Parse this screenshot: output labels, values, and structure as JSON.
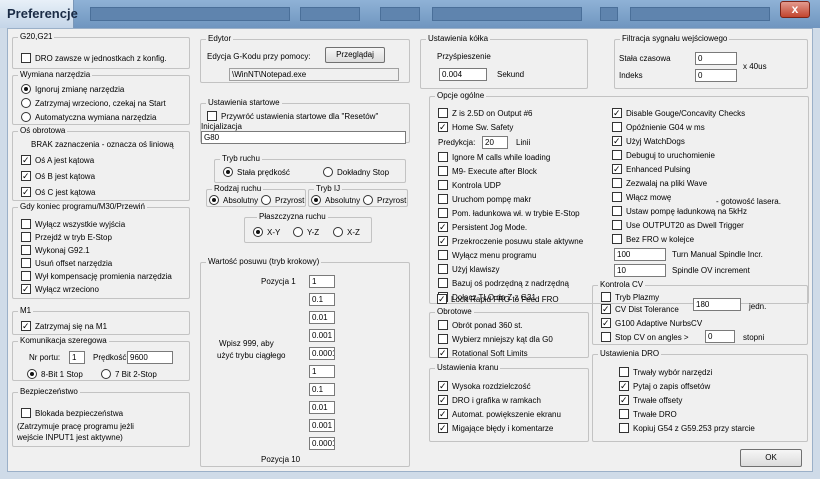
{
  "window": {
    "title": "Preferencje",
    "close_glyph": "x"
  },
  "g20": {
    "title": "G20,G21",
    "dro_units": "DRO zawsze w jednostkach z konfig."
  },
  "tool_change": {
    "title": "Wymiana narzędzia",
    "ignore": "Ignoruj zmianę narzędzia",
    "stop_spindle": "Zatrzymaj wrzeciono, czekaj na Start",
    "auto": "Automatyczna wymiana narzędzia"
  },
  "rotary": {
    "title": "Oś obrotowa",
    "note": "BRAK zaznaczenia - oznacza oś liniową",
    "a": "Oś A jest kątowa",
    "b": "Oś B jest kątowa",
    "c": "Oś C jest kątowa"
  },
  "program_end": {
    "title": "Gdy koniec programu/M30/Przewiń",
    "items": [
      "Wyłącz wszystkie wyjścia",
      "Przejdź w tryb E-Stop",
      "Wykonaj G92.1",
      "Usuń offset narzędzia",
      "Wył kompensację promienia narzędzia",
      "Wyłącz wrzeciono"
    ]
  },
  "m1": {
    "title": "M1",
    "label": "Zatrzymaj się na M1"
  },
  "serial": {
    "title": "Komunikacja szeregowa",
    "port_label": "Nr portu:",
    "port": "1",
    "speed_label": "Prędkość",
    "speed": "9600",
    "opt1": "8-Bit 1 Stop",
    "opt2": "7 Bit 2-Stop"
  },
  "safety": {
    "title": "Bezpieczeństwo",
    "lock": "Blokada bezpieczeństwa",
    "note1": "(Zatrzymuje pracę programu jeżli",
    "note2": "wejście INPUT1 jest aktywne)"
  },
  "editor": {
    "title": "Edytor",
    "label": "Edycja G-Kodu przy pomocy:",
    "browse": "Przeglądaj",
    "path": "\\WinNT\\Notepad.exe"
  },
  "startup": {
    "title": "Ustawienia startowe",
    "restore": "Przywróć ustawienia startowe dla \"Resetów\"",
    "init_label": "Inicjalizacja",
    "init_value": "G80"
  },
  "run_mode": {
    "title": "Tryb ruchu",
    "const": "Stała prędkość",
    "exact": "Dokładny Stop"
  },
  "move_type": {
    "title": "Rodzaj ruchu",
    "abs": "Absolutny",
    "inc": "Przyrost"
  },
  "ij_mode": {
    "title": "Tryb IJ",
    "abs": "Absolutny",
    "inc": "Przyrost"
  },
  "plane": {
    "title": "Płaszczyzna ruchu",
    "xy": "X-Y",
    "yz": "Y-Z",
    "xz": "X-Z"
  },
  "jog_step": {
    "title": "Wartość posuwu (tryb krokowy)",
    "first": "Pozycja 1",
    "last": "Pozycja 10",
    "hint1": "Wpisz 999, aby",
    "hint2": "użyć trybu ciągłego",
    "values": [
      "1",
      "0.1",
      "0.01",
      "0.001",
      "0.0001",
      "1",
      "0.1",
      "0.01",
      "0.001",
      "0.0001"
    ]
  },
  "mpg": {
    "title": "Ustawienia kółka",
    "accel_label": "Przyśpieszenie",
    "accel": "0.004",
    "unit": "Sekund"
  },
  "filter": {
    "title": "Filtracja sygnału wejściowego",
    "const_label": "Stała czasowa",
    "const": "0",
    "index_label": "Indeks",
    "index": "0",
    "unit": "x 40us"
  },
  "general": {
    "title": "Opcje ogólne",
    "z25": "Z is 2.5D on Output #6",
    "home_safety": "Home Sw. Safety",
    "lookahead_label": "Predykcja:",
    "lookahead": "20",
    "lookahead_unit": "Linii",
    "ignore_m": "Ignore M calls while loading",
    "m9": "M9- Execute after Block",
    "udp": "Kontrola UDP",
    "pump": "Uruchom pompę makr",
    "tool_estop": "Pom. ładunkowa wł. w trybie E-Stop",
    "persistent_jog": "Persistent Jog Mode.",
    "override_feed": "Przekroczenie posuwu stale aktywne",
    "disable_menu": "Wyłącz menu programu",
    "use_keys": "Użyj klawiszy",
    "slave_axis": "Bazuj oś podrzędną z nadrzędną",
    "tlo": "Dołącz TLO do Z z G31",
    "lock_rapid": "Lock Rapid FRO to Feed FRO",
    "gouge": "Disable Gouge/Concavity Checks",
    "g04": "Opóźnienie G04 w ms",
    "watchdogs": "Użyj WatchDogs",
    "debug": "Debuguj to uruchomienie",
    "pulsing": "Enhanced Pulsing",
    "wave": "Zezwalaj na pliki Wave",
    "speech": "Włącz mowę",
    "laser": "- gotowość lasera.",
    "pump5": "Ustaw pompę ładunkową na 5kHz",
    "dwell": "Use OUTPUT20 as Dwell Trigger",
    "no_fro": "Bez FRO w kolejce",
    "spin_incr": "100",
    "spin_incr_label": "Turn Manual Spindle Incr.",
    "spin_ov": "10",
    "spin_ov_label": "Spindle OV increment"
  },
  "rotation": {
    "title": "Obrotowe",
    "over360": "Obrót ponad 360 st.",
    "shortest": "Wybierz mniejszy kąt dla G0",
    "soft": "Rotational Soft Limits"
  },
  "screen": {
    "title": "Ustawienia kranu",
    "hires": "Wysoka rozdzielczość",
    "dro_frames": "DRO i grafika w ramkach",
    "auto_zoom": "Automat. powiększenie ekranu",
    "blink": "Migające błędy i komentarze"
  },
  "cv": {
    "title": "Kontrola CV",
    "plasma": "Tryb Plazmy",
    "dist_label": "CV Dist Tolerance",
    "dist": "180",
    "dist_unit": "jedn.",
    "nurbs": "G100 Adaptive NurbsCV",
    "stop_label": "Stop CV on angles >",
    "stop": "0",
    "stop_unit": "stopni"
  },
  "dro": {
    "title": "Ustawienia DRO",
    "persistent_tool": "Trwały wybór narzędzi",
    "ask_offsets": "Pytaj o zapis offsetów",
    "persistent_offsets": "Trwałe offsety",
    "persistent_dro": "Trwałe DRO",
    "copy_g54": "Kopiuj G54 z G59.253 przy starcie"
  },
  "ok": "OK"
}
